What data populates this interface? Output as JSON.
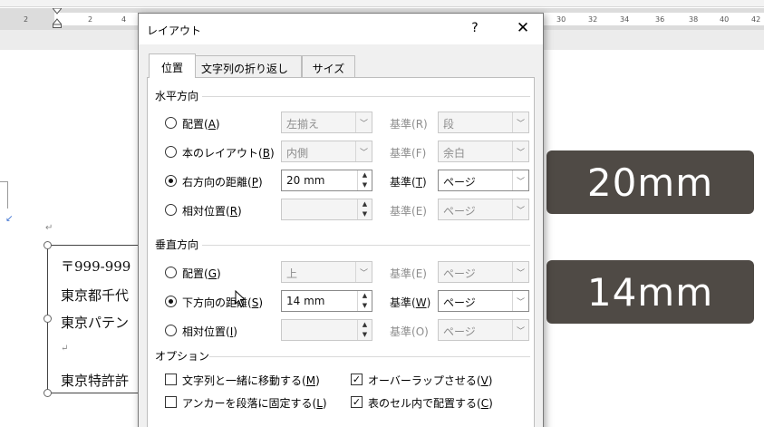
{
  "ruler": {
    "ticks": [
      "2",
      "2",
      "4",
      "30",
      "32",
      "34",
      "36",
      "38",
      "40",
      "42"
    ]
  },
  "document": {
    "return_mark": "↵",
    "small_mark": "↙",
    "textbox_lines": [
      "〒999-999",
      "東京都千代",
      "東京パテン",
      "↵",
      "東京特許許"
    ]
  },
  "overlay": {
    "horizontal_value": "20mm",
    "vertical_value": "14mm"
  },
  "dialog": {
    "title": "レイアウト",
    "help": "?",
    "close": "✕",
    "tabs": {
      "position": "位置",
      "wrap": "文字列の折り返し",
      "size": "サイズ"
    },
    "horizontal": {
      "group_label": "水平方向",
      "rows": [
        {
          "label": "配置",
          "key": "A",
          "value": "左揃え",
          "base_label": "基準",
          "base_key": "R",
          "base_value": "段",
          "checked": false
        },
        {
          "label": "本のレイアウト",
          "key": "B",
          "value": "内側",
          "base_label": "基準",
          "base_key": "F",
          "base_value": "余白",
          "checked": false
        },
        {
          "label": "右方向の距離",
          "key": "P",
          "value": "20 mm",
          "base_label": "基準",
          "base_key": "T",
          "base_value": "ページ",
          "checked": true
        },
        {
          "label": "相対位置",
          "key": "R",
          "value": "",
          "base_label": "基準",
          "base_key": "E",
          "base_value": "ページ",
          "checked": false
        }
      ]
    },
    "vertical": {
      "group_label": "垂直方向",
      "rows": [
        {
          "label": "配置",
          "key": "G",
          "value": "上",
          "base_label": "基準",
          "base_key": "E",
          "base_value": "ページ",
          "checked": false
        },
        {
          "label": "下方向の距離",
          "key": "S",
          "value": "14 mm",
          "base_label": "基準",
          "base_key": "W",
          "base_value": "ページ",
          "checked": true
        },
        {
          "label": "相対位置",
          "key": "I",
          "value": "",
          "base_label": "基準",
          "base_key": "O",
          "base_value": "ページ",
          "checked": false
        }
      ]
    },
    "options": {
      "group_label": "オプション",
      "items": [
        {
          "label": "文字列と一緒に移動する",
          "key": "M",
          "checked": false
        },
        {
          "label": "オーバーラップさせる",
          "key": "V",
          "checked": true
        },
        {
          "label": "アンカーを段落に固定する",
          "key": "L",
          "checked": false
        },
        {
          "label": "表のセル内で配置する",
          "key": "C",
          "checked": true
        }
      ]
    }
  }
}
